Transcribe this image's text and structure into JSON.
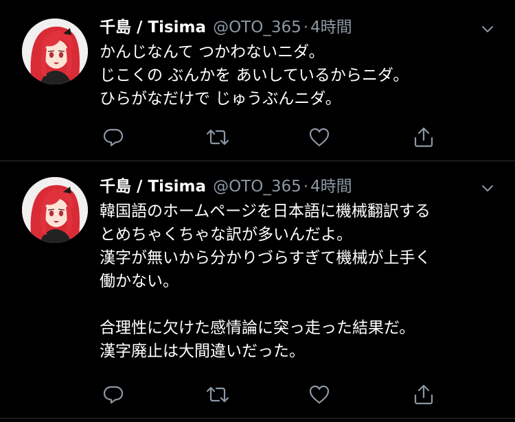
{
  "tweets": [
    {
      "display_name": "千島 / Tisima",
      "handle": "@OTO_365",
      "separator": "·",
      "time": "4時間",
      "lines": [
        "かんじなんて つかわないニダ。",
        "じこくの ぶんかを あいしているからニダ。",
        "ひらがなだけで じゅうぶんニダ。"
      ]
    },
    {
      "display_name": "千島 / Tisima",
      "handle": "@OTO_365",
      "separator": "·",
      "time": "4時間",
      "lines": [
        "韓国語のホームページを日本語に機械翻訳する",
        "とめちゃくちゃな訳が多いんだよ。",
        "漢字が無いから分かりづらすぎて機械が上手く",
        "働かない。",
        "",
        "合理性に欠けた感情論に突っ走った結果だ。",
        "漢字廃止は大間違いだった。"
      ]
    }
  ],
  "icons": {
    "reply": "reply-icon",
    "retweet": "retweet-icon",
    "like": "like-icon",
    "share": "share-icon",
    "menu": "chevron-down-icon"
  },
  "colors": {
    "background": "#000000",
    "text": "#ffffff",
    "secondary": "#8b98a5",
    "divider": "#2f3336",
    "avatar_hair": "#e0323d"
  }
}
